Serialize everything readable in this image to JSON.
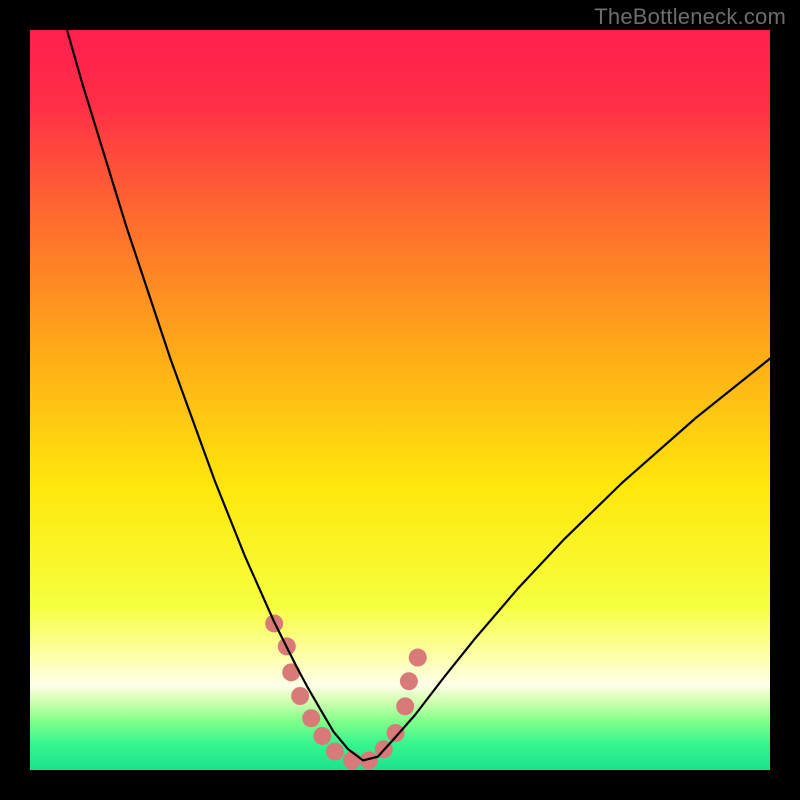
{
  "watermark": "TheBottleneck.com",
  "chart_data": {
    "type": "line",
    "title": "",
    "xlabel": "",
    "ylabel": "",
    "xlim": [
      0,
      100
    ],
    "ylim": [
      0,
      100
    ],
    "background_gradient_stops": [
      {
        "offset": 0.0,
        "color": "#ff1f4d"
      },
      {
        "offset": 0.1,
        "color": "#ff2e47"
      },
      {
        "offset": 0.25,
        "color": "#ff6a2f"
      },
      {
        "offset": 0.45,
        "color": "#ffb016"
      },
      {
        "offset": 0.62,
        "color": "#ffe80c"
      },
      {
        "offset": 0.78,
        "color": "#f6ff40"
      },
      {
        "offset": 0.84,
        "color": "#fdffa0"
      },
      {
        "offset": 0.885,
        "color": "#ffffe8"
      },
      {
        "offset": 0.905,
        "color": "#d6ffb4"
      },
      {
        "offset": 0.935,
        "color": "#7fff88"
      },
      {
        "offset": 0.965,
        "color": "#36f58f"
      },
      {
        "offset": 1.0,
        "color": "#1de28d"
      }
    ],
    "series": [
      {
        "name": "bottleneck-curve",
        "stroke": "#000000",
        "stroke_width": 2.2,
        "x": [
          5,
          7,
          9,
          11,
          13,
          15,
          17,
          19,
          21,
          23,
          25,
          27,
          29,
          31,
          33,
          34.5,
          36,
          37.5,
          39,
          41,
          43,
          45,
          47,
          49,
          52,
          56,
          60,
          66,
          72,
          80,
          90,
          100
        ],
        "y": [
          100,
          93,
          86.5,
          80,
          73.5,
          67.5,
          61.5,
          55.5,
          50,
          44.5,
          39,
          34,
          29,
          24.5,
          20,
          17,
          14,
          11.2,
          8.6,
          5.2,
          2.8,
          1.3,
          1.8,
          4.0,
          7.4,
          12.6,
          17.6,
          24.6,
          31.0,
          38.8,
          47.6,
          55.6
        ]
      }
    ],
    "scatter_overlay": {
      "name": "highlight-dots",
      "fill": "#d87a78",
      "radius": 9,
      "points": [
        {
          "x": 33.0,
          "y": 19.8
        },
        {
          "x": 34.7,
          "y": 16.7
        },
        {
          "x": 35.3,
          "y": 13.2
        },
        {
          "x": 36.5,
          "y": 10.0
        },
        {
          "x": 38.0,
          "y": 7.0
        },
        {
          "x": 39.5,
          "y": 4.6
        },
        {
          "x": 41.2,
          "y": 2.5
        },
        {
          "x": 43.5,
          "y": 1.3
        },
        {
          "x": 45.8,
          "y": 1.3
        },
        {
          "x": 47.8,
          "y": 2.8
        },
        {
          "x": 49.4,
          "y": 5.0
        },
        {
          "x": 50.7,
          "y": 8.6
        },
        {
          "x": 51.2,
          "y": 12.0
        },
        {
          "x": 52.4,
          "y": 15.2
        }
      ]
    }
  }
}
